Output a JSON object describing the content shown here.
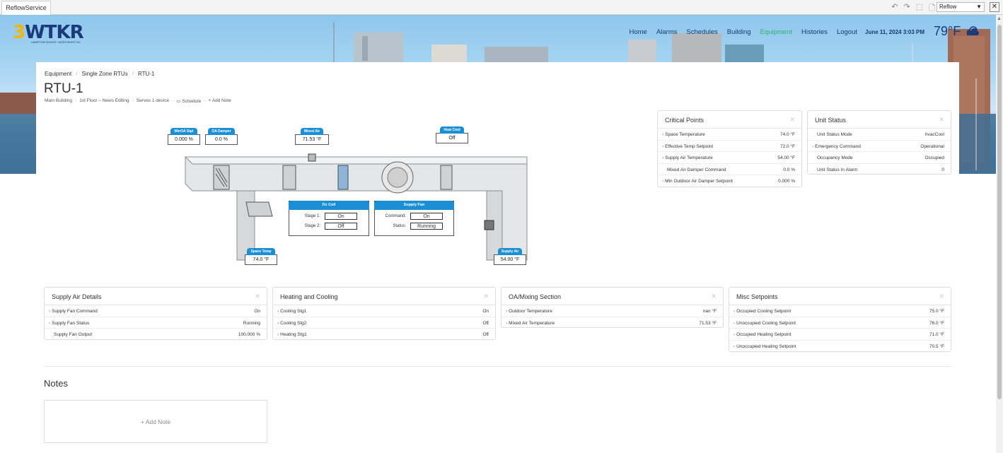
{
  "app": {
    "tab": "ReflowService",
    "view_select": "Reflow",
    "icons": [
      "undo-icon",
      "redo-icon",
      "select-icon",
      "export-icon"
    ]
  },
  "header": {
    "logo_text": "WTKR",
    "logo_number": "3",
    "logo_sub": "HAMPTON ROADS / NORTHEAST NC",
    "nav": [
      {
        "label": "Home",
        "active": false
      },
      {
        "label": "Alarms",
        "active": false
      },
      {
        "label": "Schedules",
        "active": false
      },
      {
        "label": "Building",
        "active": false
      },
      {
        "label": "Equipment",
        "active": true
      },
      {
        "label": "Histories",
        "active": false
      },
      {
        "label": "Logout",
        "active": false
      }
    ],
    "datetime": "June 11, 2024 3:03 PM",
    "temperature": "79°F",
    "weather_icon": "partly-cloudy-icon",
    "nav_active_color": "#2eb36b"
  },
  "breadcrumbs": [
    "Equipment",
    "Single Zone RTUs",
    "RTU-1"
  ],
  "page": {
    "title": "RTU-1",
    "meta": [
      "Main Building",
      "1st Floor – News Editing",
      "Serves 1 device",
      "Schedule",
      "Add Note"
    ]
  },
  "diagram": {
    "minoa": {
      "label": "MinOA Stpt",
      "value": "0.000 %"
    },
    "oa_damper": {
      "label": "OA Damper",
      "value": "0.0 %"
    },
    "mixed_air": {
      "label": "Mixed Air",
      "value": "71.53 °F"
    },
    "heat_cmd": {
      "label": "Heat Cmd",
      "value": "Off"
    },
    "dx_coil": {
      "title": "Dx Coil",
      "stage1_label": "Stage 1:",
      "stage1": "On",
      "stage2_label": "Stage 2:",
      "stage2": "Off"
    },
    "supply_fan": {
      "title": "Supply Fan",
      "command_label": "Command:",
      "command": "On",
      "status_label": "Status:",
      "status": "Running"
    },
    "space_temp": {
      "label": "Space Temp",
      "value": "74.0 °F"
    },
    "supply_air": {
      "label": "Supply Air",
      "value": "54.00 °F"
    }
  },
  "cards": {
    "critical": {
      "title": "Critical Points",
      "rows": [
        {
          "label": "Space Temperature",
          "value": "74.0 °F",
          "expandable": true
        },
        {
          "label": "Effective Temp Setpoint",
          "value": "72.0 °F",
          "expandable": true
        },
        {
          "label": "Supply Air Temperature",
          "value": "54.00 °F",
          "expandable": true
        },
        {
          "label": "Mixed Air Damper Command",
          "value": "0.0 %",
          "expandable": false
        },
        {
          "label": "Min Outdoor Air Damper Setpoint",
          "value": "0.000 %",
          "expandable": true
        }
      ]
    },
    "unit_status": {
      "title": "Unit Status",
      "rows": [
        {
          "label": "Unit Status Mode",
          "value": "hvacCool",
          "expandable": false
        },
        {
          "label": "Emergency Command",
          "value": "Operational",
          "expandable": true
        },
        {
          "label": "Occupancy Mode",
          "value": "Occupied",
          "expandable": false
        },
        {
          "label": "Unit Status In Alarm",
          "value": "0",
          "expandable": false
        }
      ]
    },
    "supply_air": {
      "title": "Supply Air Details",
      "rows": [
        {
          "label": "Supply Fan Command",
          "value": "On",
          "expandable": true
        },
        {
          "label": "Supply Fan Status",
          "value": "Running",
          "expandable": true
        },
        {
          "label": "Supply Fan Output",
          "value": "100.000 %",
          "expandable": false
        }
      ]
    },
    "heating": {
      "title": "Heating and Cooling",
      "rows": [
        {
          "label": "Cooling Stg1",
          "value": "On",
          "expandable": true
        },
        {
          "label": "Cooling Stg2",
          "value": "Off",
          "expandable": true
        },
        {
          "label": "Heating Stg1",
          "value": "Off",
          "expandable": true
        }
      ]
    },
    "oa": {
      "title": "OA/Mixing Section",
      "rows": [
        {
          "label": "Outdoor Temperature",
          "value": "nan °F",
          "expandable": true
        },
        {
          "label": "Mixed Air Temperature",
          "value": "71.53 °F",
          "expandable": true
        }
      ]
    },
    "misc": {
      "title": "Misc Setpoints",
      "rows": [
        {
          "label": "Occupied Cooling Setpoint",
          "value": "75.0 °F",
          "expandable": true
        },
        {
          "label": "Unoccupied Cooling Setpoint",
          "value": "76.0 °F",
          "expandable": true
        },
        {
          "label": "Occupied Heating Setpoint",
          "value": "71.0 °F",
          "expandable": true
        },
        {
          "label": "Unoccupied Heating Setpoint",
          "value": "70.5 °F",
          "expandable": true
        }
      ]
    }
  },
  "notes": {
    "title": "Notes",
    "add_label": "+ Add Note"
  },
  "card_close_icon": "close-icon"
}
